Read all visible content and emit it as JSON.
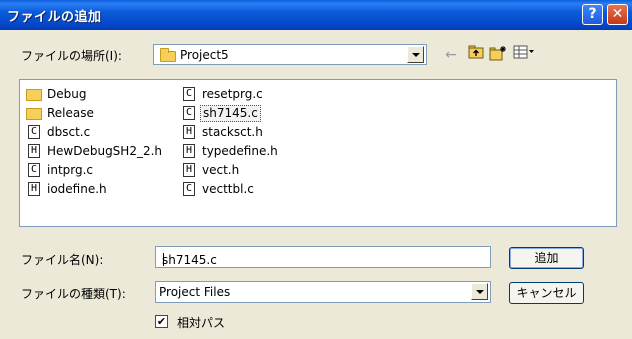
{
  "window": {
    "title": "ファイルの追加",
    "help_label": "?",
    "close_label": "✕"
  },
  "lookin": {
    "label": "ファイルの場所(I):",
    "value": "Project5"
  },
  "toolbar": {
    "back_icon": "arrow-left-icon",
    "up_icon": "folder-up-icon",
    "newfolder_icon": "new-folder-icon",
    "view_icon": "view-menu-icon"
  },
  "files": {
    "col1": [
      {
        "name": "Debug",
        "type": "folder"
      },
      {
        "name": "Release",
        "type": "folder"
      },
      {
        "name": "dbsct.c",
        "type": "C"
      },
      {
        "name": "HewDebugSH2_2.h",
        "type": "H"
      },
      {
        "name": "intprg.c",
        "type": "C"
      },
      {
        "name": "iodefine.h",
        "type": "H"
      }
    ],
    "col2": [
      {
        "name": "resetprg.c",
        "type": "C"
      },
      {
        "name": "sh7145.c",
        "type": "C",
        "selected": true
      },
      {
        "name": "stacksct.h",
        "type": "H"
      },
      {
        "name": "typedefine.h",
        "type": "H"
      },
      {
        "name": "vect.h",
        "type": "H"
      },
      {
        "name": "vecttbl.c",
        "type": "C"
      }
    ]
  },
  "filename": {
    "label": "ファイル名(N):",
    "value": "sh7145.c"
  },
  "filetype": {
    "label": "ファイルの種類(T):",
    "value": "Project Files"
  },
  "buttons": {
    "add": "追加",
    "cancel": "キャンセル"
  },
  "relative": {
    "label": "相対パス",
    "checked": true,
    "mark": "✔"
  }
}
